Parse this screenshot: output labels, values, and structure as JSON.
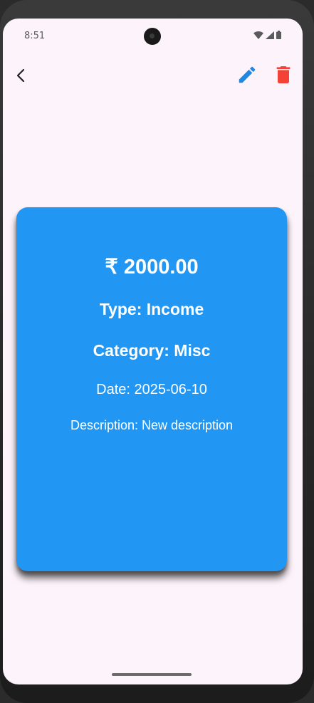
{
  "status_bar": {
    "time": "8:51",
    "icons": [
      "wifi-icon",
      "signal-icon",
      "battery-icon"
    ]
  },
  "app_bar": {
    "back_icon": "chevron-left-icon",
    "edit_icon": "pencil-icon",
    "delete_icon": "trash-icon",
    "colors": {
      "edit": "#1e88e5",
      "delete": "#f44336"
    }
  },
  "transaction": {
    "amount": "₹ 2000.00",
    "type": "Type: Income",
    "category": "Category: Misc",
    "date": "Date: 2025-06-10",
    "description": "Description: New description"
  },
  "colors": {
    "card": "#2196f3",
    "background": "#fdf4fb"
  }
}
